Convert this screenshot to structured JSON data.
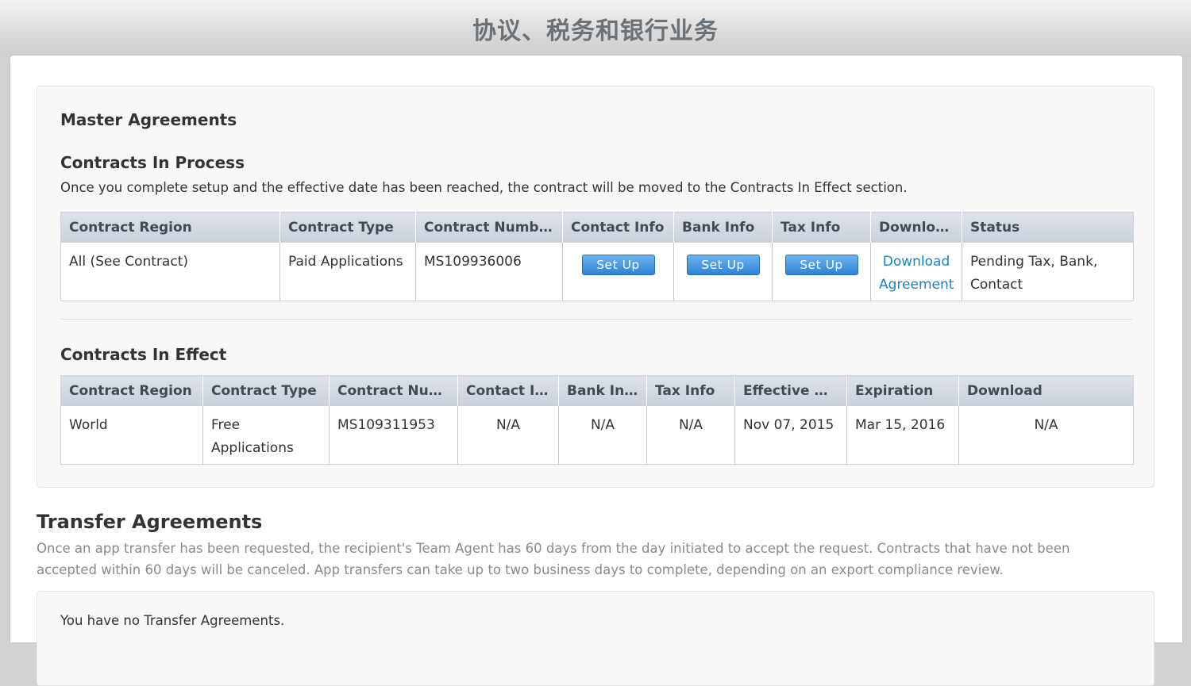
{
  "header": {
    "title": "协议、税务和银行业务"
  },
  "master": {
    "title": "Master Agreements",
    "in_process": {
      "title": "Contracts In Process",
      "description": "Once you complete setup and the effective date has been reached, the contract will be moved to the Contracts In Effect section.",
      "columns": [
        "Contract Region",
        "Contract Type",
        "Contract Number",
        "Contact Info",
        "Bank Info",
        "Tax Info",
        "Download",
        "Status"
      ],
      "row": {
        "region": "All (See Contract)",
        "type": "Paid Applications",
        "number": "MS109936006",
        "contact_button": "Set Up",
        "bank_button": "Set Up",
        "tax_button": "Set Up",
        "download_link": "Download Agreement",
        "status": "Pending Tax, Bank, Contact"
      }
    },
    "in_effect": {
      "title": "Contracts In Effect",
      "columns": [
        "Contract Region",
        "Contract Type",
        "Contract Num…",
        "Contact Info",
        "Bank Info",
        "Tax Info",
        "Effective Date",
        "Expiration",
        "Download"
      ],
      "row": {
        "region": "World",
        "type": "Free Applications",
        "number": "MS109311953",
        "contact": "N/A",
        "bank": "N/A",
        "tax": "N/A",
        "effective": "Nov 07, 2015",
        "expiration": "Mar 15, 2016",
        "download": "N/A"
      }
    }
  },
  "transfer": {
    "title": "Transfer Agreements",
    "description": "Once an app transfer has been requested, the recipient's Team Agent has 60 days from the day initiated to accept the request. Contracts that have not been accepted within 60 days will be canceled. App transfers can take up to two business days to complete, depending on an export compliance review.",
    "empty_message": "You have no Transfer Agreements."
  }
}
